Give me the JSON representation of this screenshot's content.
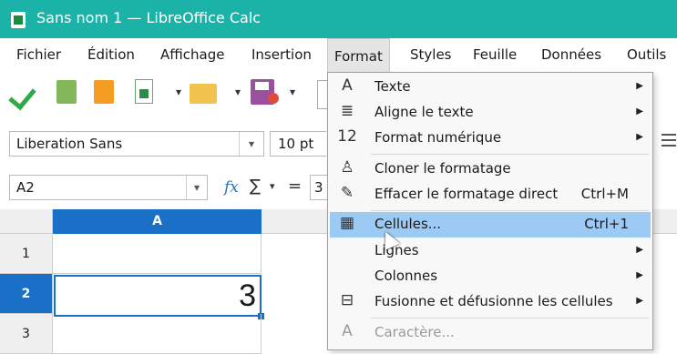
{
  "window": {
    "title": "Sans nom 1 — LibreOffice Calc",
    "accent": "#1bb3a8"
  },
  "menubar": {
    "items": [
      {
        "label": "Fichier"
      },
      {
        "label": "Édition"
      },
      {
        "label": "Affichage"
      },
      {
        "label": "Insertion"
      },
      {
        "label": "Format"
      },
      {
        "label": "Styles"
      },
      {
        "label": "Feuille"
      },
      {
        "label": "Données"
      },
      {
        "label": "Outils"
      }
    ],
    "active": "Format"
  },
  "toolbar": {
    "icons": [
      "checkmark-icon",
      "book-green-icon",
      "book-orange-icon",
      "new-spreadsheet-icon",
      "open-folder-icon",
      "save-icon"
    ]
  },
  "format_bar": {
    "font_name": "Liberation Sans",
    "font_size": "10 pt"
  },
  "formula_bar": {
    "name_box": "A2",
    "fx": "fx",
    "sigma": "∑",
    "equals": "=",
    "input_value": "3"
  },
  "grid": {
    "columns": [
      {
        "label": "A"
      }
    ],
    "rows": [
      {
        "label": "1"
      },
      {
        "label": "2"
      },
      {
        "label": "3"
      }
    ],
    "selected_cell": "A2",
    "cell_a2_value": "3",
    "selection_color": "#1a6fc7"
  },
  "format_menu": {
    "items": [
      {
        "icon": "A",
        "label": "Texte",
        "shortcut": "",
        "submenu": true
      },
      {
        "icon": "≣",
        "label": "Aligne le texte",
        "shortcut": "",
        "submenu": true
      },
      {
        "icon": "12",
        "label": "Format numérique",
        "shortcut": "",
        "submenu": true
      },
      {
        "icon": "♙",
        "label": "Cloner le formatage",
        "shortcut": "",
        "submenu": false
      },
      {
        "icon": "✎",
        "label": "Effacer le formatage direct",
        "shortcut": "Ctrl+M",
        "submenu": false
      },
      {
        "icon": "▦",
        "label": "Cellules...",
        "shortcut": "Ctrl+1",
        "submenu": false,
        "highlighted": true
      },
      {
        "icon": "",
        "label": "Lignes",
        "shortcut": "",
        "submenu": true
      },
      {
        "icon": "",
        "label": "Colonnes",
        "shortcut": "",
        "submenu": true
      },
      {
        "icon": "⊟",
        "label": "Fusionne et défusionne les cellules",
        "shortcut": "",
        "submenu": true
      },
      {
        "icon": "A",
        "label": "Caractère...",
        "shortcut": "",
        "submenu": false,
        "disabled": true
      }
    ],
    "highlight_color": "#9ccaf4"
  }
}
